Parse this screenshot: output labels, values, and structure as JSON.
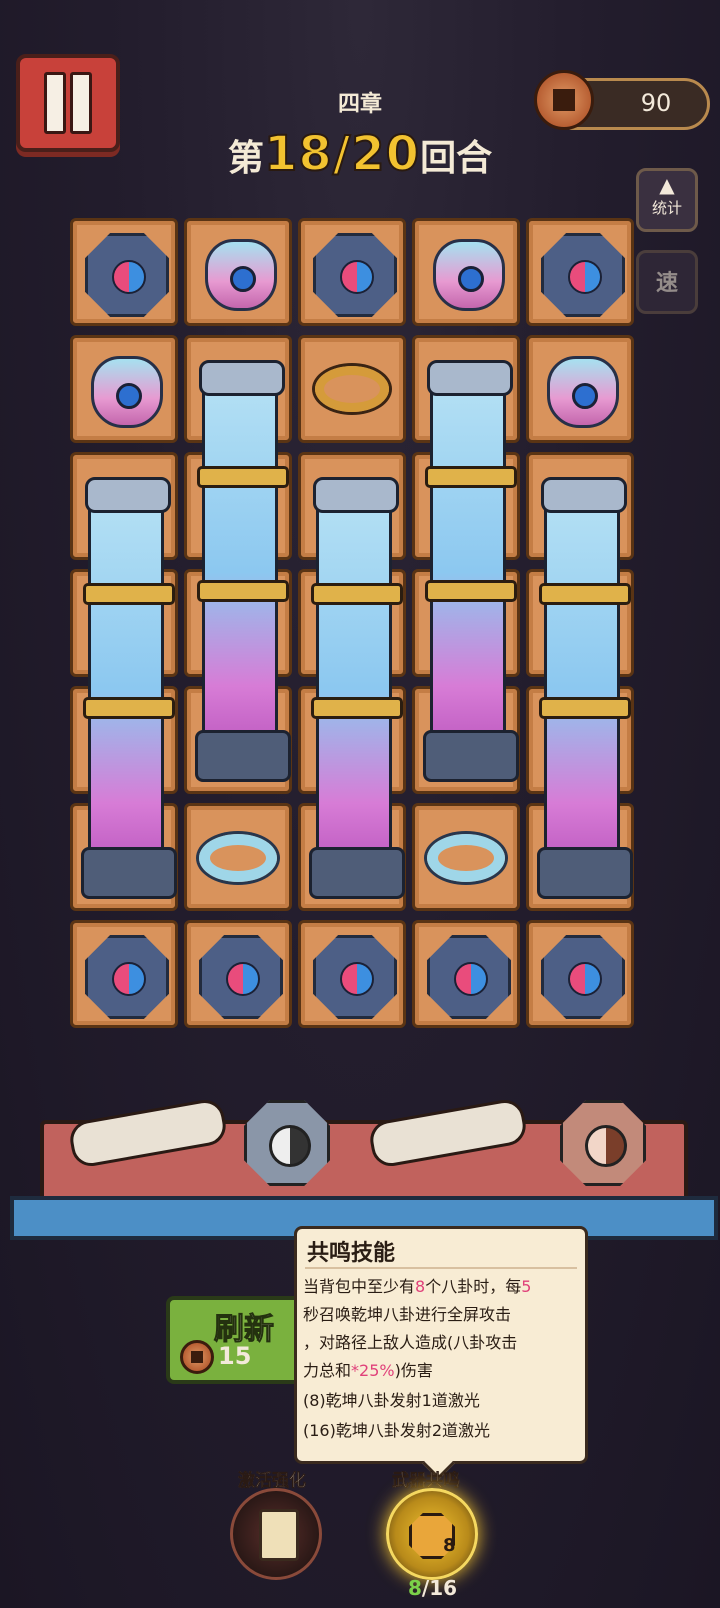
{
  "hud": {
    "chapter": "四章",
    "round_prefix": "第",
    "round_current": "18",
    "round_sep": "/",
    "round_total": "20",
    "round_suffix": "回合",
    "coins": "90",
    "stats_label": "统计",
    "speed_label": "速"
  },
  "grid": {
    "rows": [
      [
        "bagua",
        "bag",
        "bagua",
        "bag",
        "bagua"
      ],
      [
        "bag",
        "pillar",
        "gold-ring",
        "pillar",
        "bag"
      ],
      [
        "pillar",
        "pillar",
        "pillar",
        "pillar",
        "pillar"
      ],
      [
        "pillar",
        "pillar",
        "pillar",
        "pillar",
        "pillar"
      ],
      [
        "pillar",
        "pillar",
        "pillar",
        "pillar",
        "pillar"
      ],
      [
        "pillar",
        "jade-ring",
        "pillar",
        "jade-ring",
        "pillar"
      ],
      [
        "bagua",
        "bagua",
        "bagua",
        "bagua",
        "bagua"
      ]
    ]
  },
  "shop": {
    "refresh_label": "刷新",
    "refresh_cost": "15"
  },
  "tooltip": {
    "title": "共鸣技能",
    "l1a": "当背包中至少有",
    "l1b": "8",
    "l1c": "个八卦时，每",
    "l1d": "5",
    "l2": "秒召唤乾坤八卦进行全屏攻击",
    "l3": "，对路径上敌人造成(八卦攻击",
    "l4a": "力总和",
    "l4b": "*25%",
    "l4c": ")伤害",
    "l5": "(8)乾坤八卦发射1道激光",
    "l6": "(16)乾坤八卦发射2道激光"
  },
  "bottom": {
    "activate_label": "激活强化",
    "resonance_label": "武器共鸣",
    "resonance_badge": "8",
    "resonance_progress_cur": "8",
    "resonance_progress_sep": "/",
    "resonance_progress_total": "16"
  },
  "colors": {
    "tile": "#d9935c",
    "accent_gold": "#f2c230",
    "pause_red": "#c8413a",
    "refresh_green": "#7ab13e"
  }
}
